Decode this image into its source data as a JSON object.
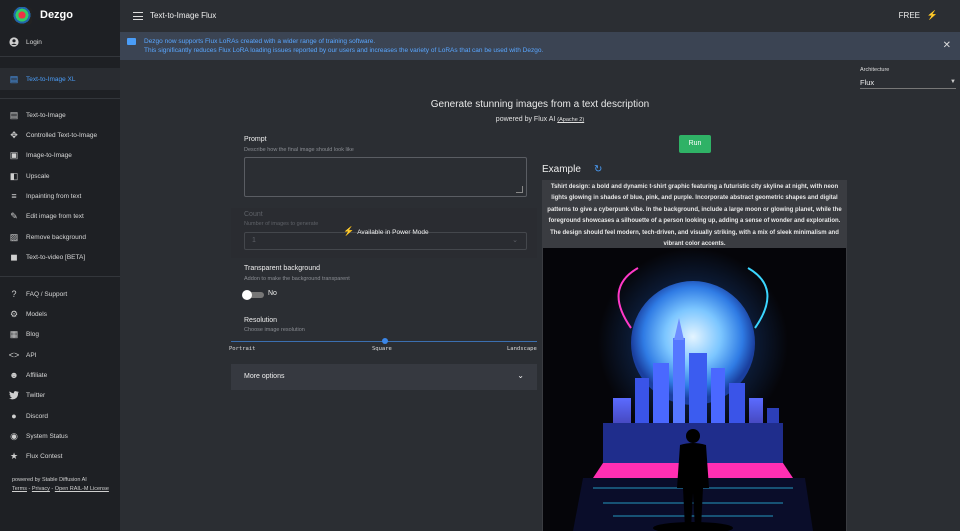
{
  "app": {
    "name": "Dezgo"
  },
  "sidebar": {
    "login": "Login",
    "items": [
      {
        "label": "Text-to-Image XL",
        "icon": "chat-image-icon",
        "active": true
      },
      {
        "label": "Text-to-Image",
        "icon": "chat-image-icon"
      },
      {
        "label": "Controlled Text-to-Image",
        "icon": "move-arrows-icon"
      },
      {
        "label": "Image-to-Image",
        "icon": "images-icon"
      },
      {
        "label": "Upscale",
        "icon": "upscale-icon"
      },
      {
        "label": "Inpainting from text",
        "icon": "inpaint-icon"
      },
      {
        "label": "Edit image from text",
        "icon": "edit-text-icon"
      },
      {
        "label": "Remove background",
        "icon": "remove-bg-icon"
      },
      {
        "label": "Text-to-video [BETA]",
        "icon": "video-icon"
      }
    ],
    "links": [
      {
        "label": "FAQ / Support",
        "icon": "question-icon"
      },
      {
        "label": "Models",
        "icon": "models-icon"
      },
      {
        "label": "Blog",
        "icon": "blog-icon"
      },
      {
        "label": "API",
        "icon": "code-icon"
      },
      {
        "label": "Affiliate",
        "icon": "people-icon"
      },
      {
        "label": "Twitter",
        "icon": "twitter-icon"
      },
      {
        "label": "Discord",
        "icon": "discord-icon"
      },
      {
        "label": "System Status",
        "icon": "status-icon"
      },
      {
        "label": "Flux Contest",
        "icon": "star-icon"
      }
    ],
    "footer": {
      "powered_by": "powered by Stable Diffusion AI",
      "terms": "Terms",
      "sep1": " - ",
      "privacy": "Privacy",
      "sep2": " - ",
      "license": "Open RAIL-M License"
    }
  },
  "topbar": {
    "title": "Text-to-Image Flux",
    "plan": "FREE"
  },
  "banner": {
    "line1": "Dezgo now supports Flux LoRAs created with a wider range of training software.",
    "line2": "This significantly reduces Flux LoRA loading issues reported by our users and increases the variety of LoRAs that can be used with Dezgo."
  },
  "architecture": {
    "label": "Architecture",
    "value": "Flux"
  },
  "main": {
    "headline": "Generate stunning images from a text description",
    "subhead_prefix": "powered by Flux AI ",
    "subhead_license": "(Apache 2)",
    "prompt": {
      "title": "Prompt",
      "help": "Describe how the final image should look like",
      "value": ""
    },
    "run_label": "Run",
    "count": {
      "title": "Count",
      "help": "Number of images to generate",
      "value": "1",
      "power_mode": "Available in Power Mode"
    },
    "transparent": {
      "title": "Transparent background",
      "help": "Addon to make the background transparent",
      "state": "No"
    },
    "resolution": {
      "title": "Resolution",
      "help": "Choose image resolution",
      "options": [
        "Portrait",
        "Square",
        "Landscape"
      ],
      "selected": "Square"
    },
    "more_options": "More options"
  },
  "example": {
    "title": "Example",
    "text": "Tshirt design: a bold and dynamic t-shirt graphic featuring a futuristic city skyline at night, with neon lights glowing in shades of blue, pink, and purple. Incorporate abstract geometric shapes and digital patterns to give a cyberpunk vibe. In the background, include a large moon or glowing planet, while the foreground showcases a silhouette of a person looking up, adding a sense of wonder and exploration. The design should feel modern, tech-driven, and visually striking, with a mix of sleek minimalism and vibrant color accents."
  },
  "colors": {
    "accent": "#4a9df8",
    "run_button": "#2fb266",
    "sidebar_bg": "#1e2024",
    "main_bg": "#2b2e33",
    "banner_bg": "#3b4453"
  }
}
